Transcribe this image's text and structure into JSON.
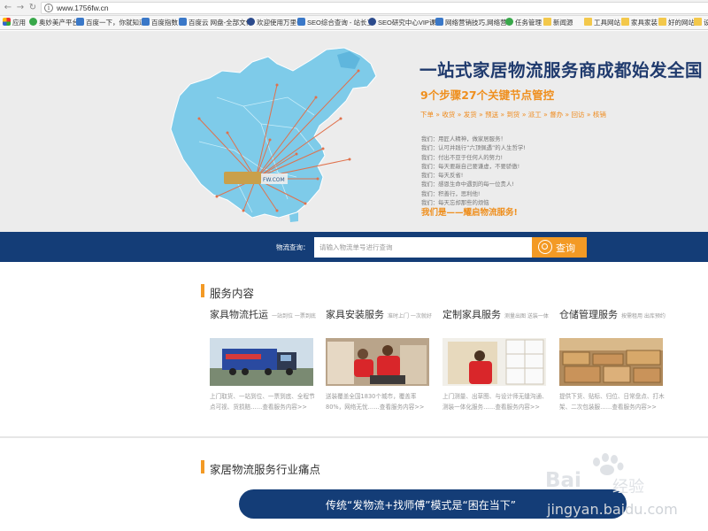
{
  "browser": {
    "url": "www.1756fw.cn",
    "bookmarks": [
      {
        "label": "应用",
        "icon": "apps-icon"
      },
      {
        "label": "奥妙美产平台",
        "icon": "globe-icon"
      },
      {
        "label": "百度一下，你就知道",
        "icon": "baidu-icon"
      },
      {
        "label": "百度指数",
        "icon": "baidu-icon"
      },
      {
        "label": "百度云 网盘-全部文件",
        "icon": "cloud-icon"
      },
      {
        "label": "欢迎使用万里牛",
        "icon": "h-icon"
      },
      {
        "label": "SEO综合查询 - 站长工",
        "icon": "seo-icon"
      },
      {
        "label": "SEO研究中心VIP课程",
        "icon": "seo-icon"
      },
      {
        "label": "网络营销技巧,网络营",
        "icon": "doc-icon"
      },
      {
        "label": "任务管理",
        "icon": "at-icon"
      },
      {
        "label": "新闻源",
        "icon": "folder-icon"
      },
      {
        "label": "工具网站",
        "icon": "folder-icon"
      },
      {
        "label": "家具家装",
        "icon": "folder-icon"
      },
      {
        "label": "好的网站",
        "icon": "folder-icon"
      },
      {
        "label": "设计",
        "icon": "folder-icon"
      }
    ]
  },
  "hero": {
    "title": "一站式家居物流服务商成都始发全国",
    "subtitle": "9个步骤27个关键节点管控",
    "steps": [
      "下单",
      "收货",
      "发货",
      "预送",
      "到货",
      "派工",
      "督办",
      "回访",
      "核销"
    ],
    "lines": [
      "我们：用匠人精神，做家居服务！",
      "我们：认可并践行“六顶佩遇”的人生哲学!",
      "我们：付出不亚于任何人的努力!",
      "我们：每天要敲自己要谦虚，不要骄傲!",
      "我们：每天反省!",
      "我们：感恩生命中遇到的每一位贵人!",
      "我们：积善行，思利他!",
      "我们：每天忘却那些的烦恼"
    ],
    "slogan": "我们是——耀启物流服务!",
    "map_logo": "FW.COM"
  },
  "search": {
    "label": "物流查询：",
    "placeholder": "请输入物流单号进行查询",
    "button": "查询"
  },
  "services": {
    "title": "服务内容",
    "items": [
      {
        "title": "家具物流托运",
        "tag": "一站到位 一票到底",
        "desc": "上门取货、一站到位、一票到底、全程节点可视、货损赔……查看服务内容>>"
      },
      {
        "title": "家具安装服务",
        "tag": "准时上门 一次就好",
        "desc": "送装覆盖全国1830个城市，覆盖率80%，网络无忧……查看服务内容>>"
      },
      {
        "title": "定制家具服务",
        "tag": "测量出图 送装一体",
        "desc": "上门测量、出草图、与设计师无缝沟通、测装一体化服务……查看服务内容>>"
      },
      {
        "title": "仓储管理服务",
        "tag": "按需租用 出库预约",
        "desc": "提供下货、贴标、归位、日常盘点、打木架、二次包装服……查看服务内容>>"
      }
    ]
  },
  "pain": {
    "title": "家居物流服务行业痛点",
    "banner": "传统“发物流+找师傅”模式是“困在当下”"
  },
  "watermark": {
    "logo": "Bai",
    "logo2": "经验",
    "url": "jingyan.baidu.com"
  }
}
